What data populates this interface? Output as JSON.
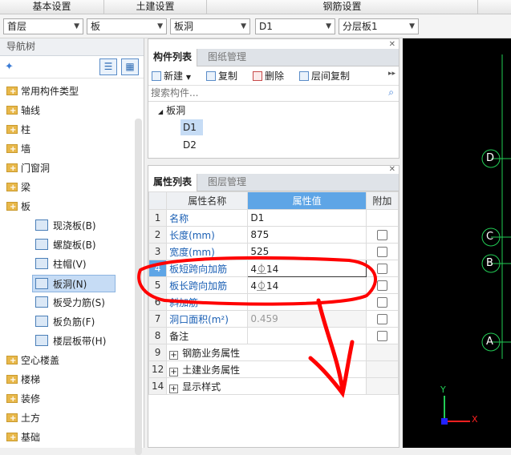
{
  "menu": {
    "sections": [
      "基本设置",
      "土建设置",
      "钢筋设置"
    ]
  },
  "toolbar": {
    "floor": "首层",
    "category": "板",
    "component_type": "板洞",
    "component": "D1",
    "layer": "分层板1"
  },
  "nav": {
    "title": "导航树",
    "items": [
      {
        "label": "常用构件类型"
      },
      {
        "label": "轴线"
      },
      {
        "label": "柱"
      },
      {
        "label": "墙"
      },
      {
        "label": "门窗洞"
      },
      {
        "label": "梁"
      },
      {
        "label": "板"
      },
      {
        "label": "现浇板(B)"
      },
      {
        "label": "螺旋板(B)"
      },
      {
        "label": "柱帽(V)"
      },
      {
        "label": "板洞(N)"
      },
      {
        "label": "板受力筋(S)"
      },
      {
        "label": "板负筋(F)"
      },
      {
        "label": "楼层板带(H)"
      },
      {
        "label": "空心楼盖"
      },
      {
        "label": "楼梯"
      },
      {
        "label": "装修"
      },
      {
        "label": "土方"
      },
      {
        "label": "基础"
      }
    ]
  },
  "component_list": {
    "tabs": [
      "构件列表",
      "图纸管理"
    ],
    "buttons": {
      "new": "新建",
      "copy": "复制",
      "delete": "删除",
      "layer_copy": "层间复制"
    },
    "search_placeholder": "搜索构件...",
    "tree_root": "板洞",
    "tree_items": [
      "D1",
      "D2"
    ]
  },
  "properties": {
    "tabs": [
      "属性列表",
      "图层管理"
    ],
    "headers": {
      "name": "属性名称",
      "value": "属性值",
      "extra": "附加"
    },
    "rows": [
      {
        "num": "1",
        "name": "名称",
        "value": "D1"
      },
      {
        "num": "2",
        "name": "长度(mm)",
        "value": "875"
      },
      {
        "num": "3",
        "name": "宽度(mm)",
        "value": "525"
      },
      {
        "num": "4",
        "name": "板短跨向加筋",
        "value": "4⏂14"
      },
      {
        "num": "5",
        "name": "板长跨向加筋",
        "value": "4⏂14"
      },
      {
        "num": "6",
        "name": "斜加筋",
        "value": ""
      },
      {
        "num": "7",
        "name": "洞口面积(m²)",
        "value": "0.459"
      },
      {
        "num": "8",
        "name": "备注",
        "value": ""
      },
      {
        "num": "9",
        "name": "钢筋业务属性",
        "value": ""
      },
      {
        "num": "12",
        "name": "土建业务属性",
        "value": ""
      },
      {
        "num": "14",
        "name": "显示样式",
        "value": ""
      }
    ]
  },
  "canvas": {
    "axis_labels": [
      "D",
      "C",
      "B",
      "A"
    ],
    "x_axis": "X",
    "y_axis": "Y"
  },
  "colors": {
    "accent": "#5ea5e6",
    "annotation": "#ff0000",
    "grid": "#00cc44"
  }
}
